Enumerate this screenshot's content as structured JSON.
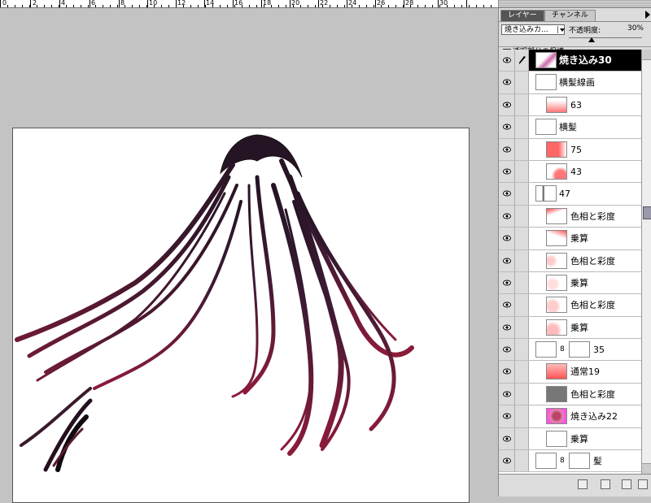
{
  "ruler": {
    "labels": [
      "0",
      "2",
      "4",
      "6",
      "8",
      "10",
      "12",
      "14",
      "16",
      "18",
      "20",
      "22",
      "24",
      "26",
      "28",
      "30"
    ]
  },
  "panel": {
    "tabs": {
      "layers": "レイヤー",
      "channels": "チャンネル"
    },
    "blend_mode": "焼き込みカ...",
    "opacity_label": "不透明度:",
    "opacity_value": "30%",
    "opacity_level": 0.3,
    "preserve_label": "透明部分の保護"
  },
  "layers": [
    {
      "name": "焼き込み30",
      "selected": true
    },
    {
      "name": "横髪線画"
    },
    {
      "name": "63"
    },
    {
      "name": "横髪"
    },
    {
      "name": "75"
    },
    {
      "name": "43"
    },
    {
      "name": "47"
    },
    {
      "name": "色相と彩度"
    },
    {
      "name": "乗算"
    },
    {
      "name": "色相と彩度"
    },
    {
      "name": "乗算"
    },
    {
      "name": "色相と彩度"
    },
    {
      "name": "乗算"
    },
    {
      "name": "35"
    },
    {
      "name": "通常19"
    },
    {
      "name": "色相と彩度"
    },
    {
      "name": "焼き込み22"
    },
    {
      "name": "乗算"
    },
    {
      "name": "髪"
    }
  ],
  "colors": {
    "hair_dark": "#2a1525",
    "hair_red": "#8a1a38",
    "selected": "#000000"
  }
}
